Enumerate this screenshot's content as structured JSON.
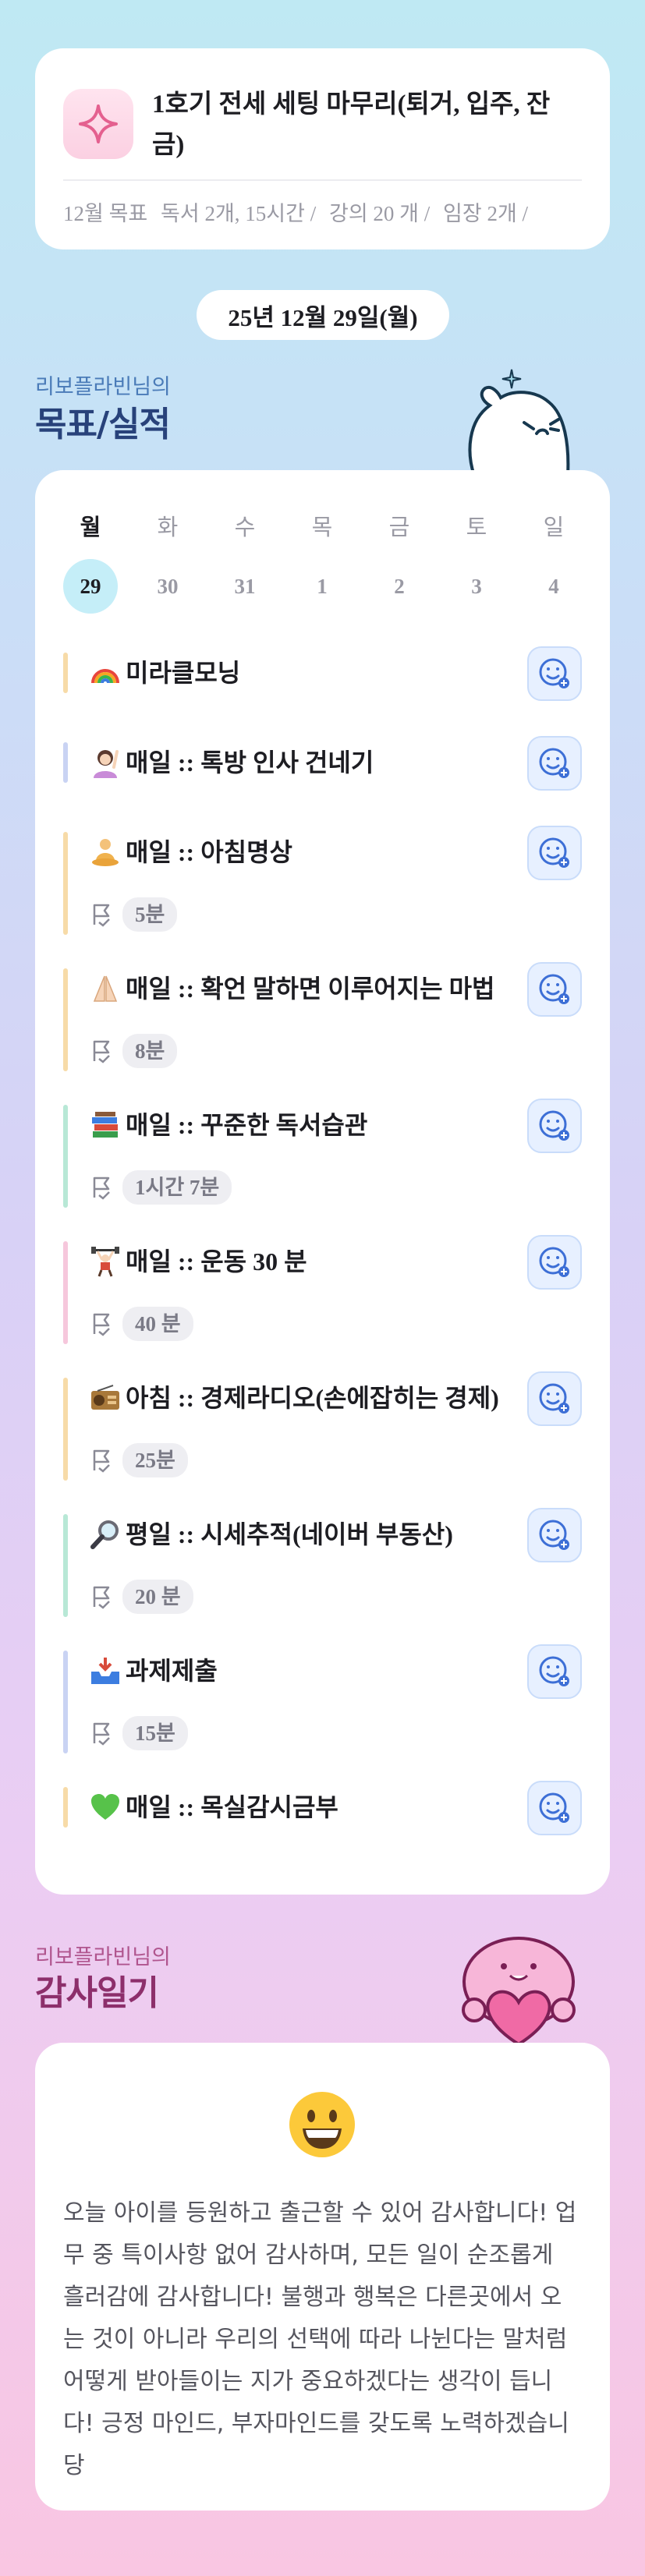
{
  "goal_card": {
    "title": "1호기 전세 세팅 마무리(퇴거, 입주, 잔금)",
    "meta": [
      "12월 목표",
      "독서 2개, 15시간 /",
      "강의 20 개 /",
      "임장 2개 /"
    ]
  },
  "date": "25년 12월 29일(월)",
  "goals_section": {
    "subtitle": "리보플라빈님의",
    "title": "목표/실적"
  },
  "week": {
    "days": [
      "월",
      "화",
      "수",
      "목",
      "금",
      "토",
      "일"
    ],
    "dates": [
      "29",
      "30",
      "31",
      "1",
      "2",
      "3",
      "4"
    ],
    "active_index": 0
  },
  "items": [
    {
      "emoji": "rainbow",
      "label": "미라클모닝",
      "duration": "",
      "color": "#f7dba8"
    },
    {
      "emoji": "person",
      "label": "매일 :: 톡방 인사 건네기",
      "duration": "",
      "color": "#c9d3f3"
    },
    {
      "emoji": "meditate",
      "label": "매일 :: 아침명상",
      "duration": "5분",
      "color": "#f7dba8"
    },
    {
      "emoji": "pray",
      "label": "매일 :: 확언 말하면 이루어지는 마법",
      "duration": "8분",
      "color": "#f7dba8"
    },
    {
      "emoji": "books",
      "label": "매일 :: 꾸준한 독서습관",
      "duration": "1시간 7분",
      "color": "#b8e8d6"
    },
    {
      "emoji": "lift",
      "label": "매일 :: 운동 30 분",
      "duration": "40 분",
      "color": "#f6c7dc"
    },
    {
      "emoji": "radio",
      "label": "아침 :: 경제라디오(손에잡히는 경제)",
      "duration": "25분",
      "color": "#f7dba8"
    },
    {
      "emoji": "magnifier",
      "label": "평일 :: 시세추적(네이버 부동산)",
      "duration": "20 분",
      "color": "#b8e8d6"
    },
    {
      "emoji": "inbox",
      "label": "과제제출",
      "duration": "15분",
      "color": "#c9d3f3"
    },
    {
      "emoji": "green-heart",
      "label": "매일 :: 목실감시금부",
      "duration": "",
      "color": "#f7dba8"
    }
  ],
  "gratitude_section": {
    "subtitle": "리보플라빈님의",
    "title": "감사일기"
  },
  "gratitude": {
    "emoji": "smiley",
    "text": "오늘 아이를 등원하고 출근할 수 있어 감사합니다! 업무 중 특이사항 없어 감사하며, 모든 일이 순조롭게 흘러감에 감사합니다! 불행과 행복은 다른곳에서 오는 것이 아니라 우리의 선택에 따라 나뉜다는 말처럼 어떻게 받아들이는 지가 중요하겠다는 생각이 듭니다! 긍정 마인드, 부자마인드를 갖도록 노력하겠습니당"
  },
  "colors": {
    "accent": "#3d6fd6",
    "title": "#28427a",
    "today": "#c5eef8"
  }
}
